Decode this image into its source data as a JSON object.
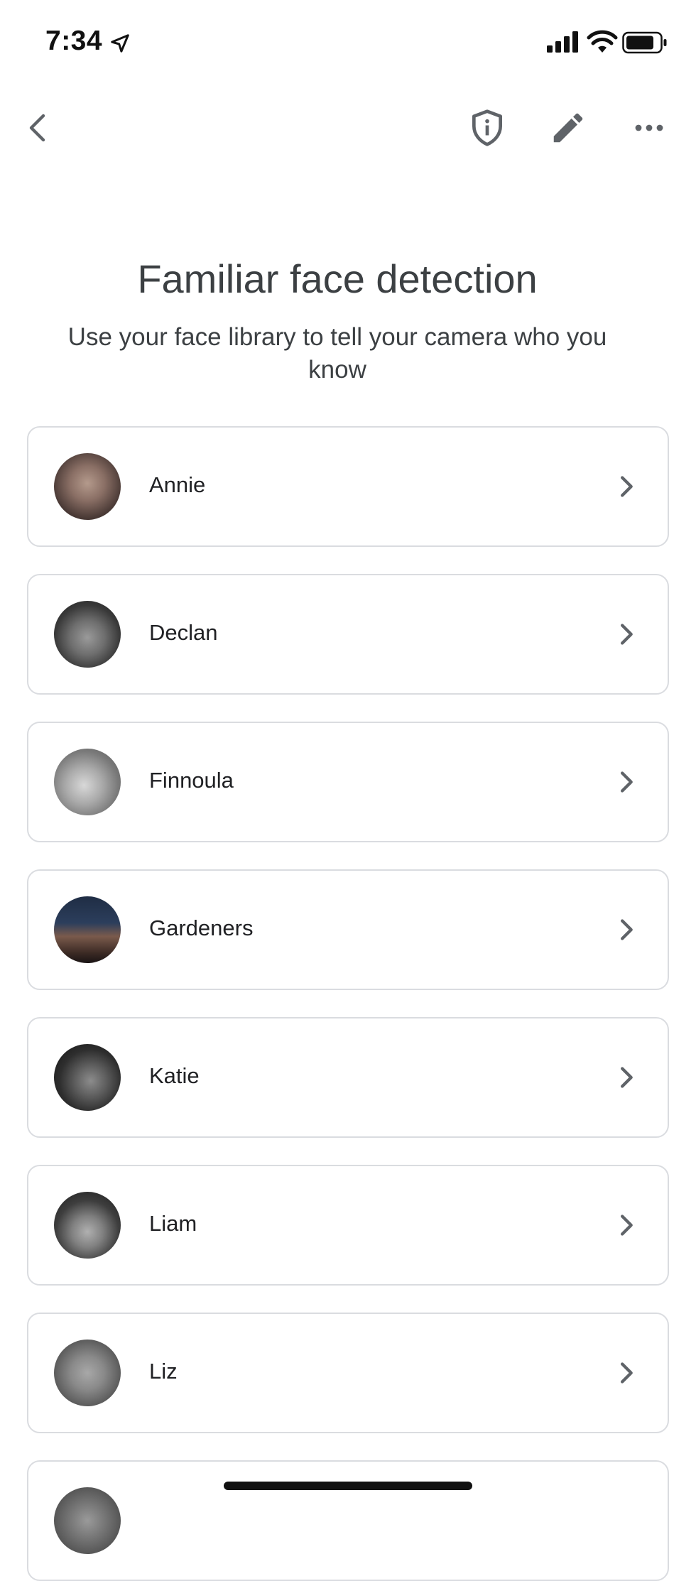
{
  "status_bar": {
    "time": "7:34"
  },
  "page": {
    "title": "Familiar face detection",
    "subtitle": "Use your face library to tell your camera who you know"
  },
  "icons": {
    "back": "back-arrow-icon",
    "shield": "shield-info-icon",
    "edit": "pencil-icon",
    "more": "more-horizontal-icon",
    "chevron": "chevron-right-icon"
  },
  "faces": [
    {
      "name": "Annie",
      "tone": "warm"
    },
    {
      "name": "Declan",
      "tone": "dark"
    },
    {
      "name": "Finnoula",
      "tone": "light"
    },
    {
      "name": "Gardeners",
      "tone": "cap"
    },
    {
      "name": "Katie",
      "tone": "glasses"
    },
    {
      "name": "Liam",
      "tone": "glasses-light"
    },
    {
      "name": "Liz",
      "tone": "grey"
    },
    {
      "name": "",
      "tone": "grey"
    }
  ]
}
